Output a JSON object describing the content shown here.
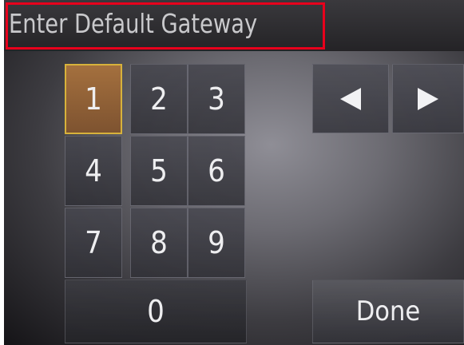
{
  "header": {
    "title": "Enter Default Gateway"
  },
  "keypad": {
    "digits": [
      "1",
      "2",
      "3",
      "4",
      "5",
      "6",
      "7",
      "8",
      "9"
    ],
    "zero": "0",
    "selected": "1"
  },
  "navigation": {
    "left_icon": "left-arrow-icon",
    "right_icon": "right-arrow-icon"
  },
  "actions": {
    "done_label": "Done"
  },
  "colors": {
    "highlight_border": "#e8001c",
    "selected_key": "#a4703e",
    "selected_outline": "#d7b23b"
  }
}
